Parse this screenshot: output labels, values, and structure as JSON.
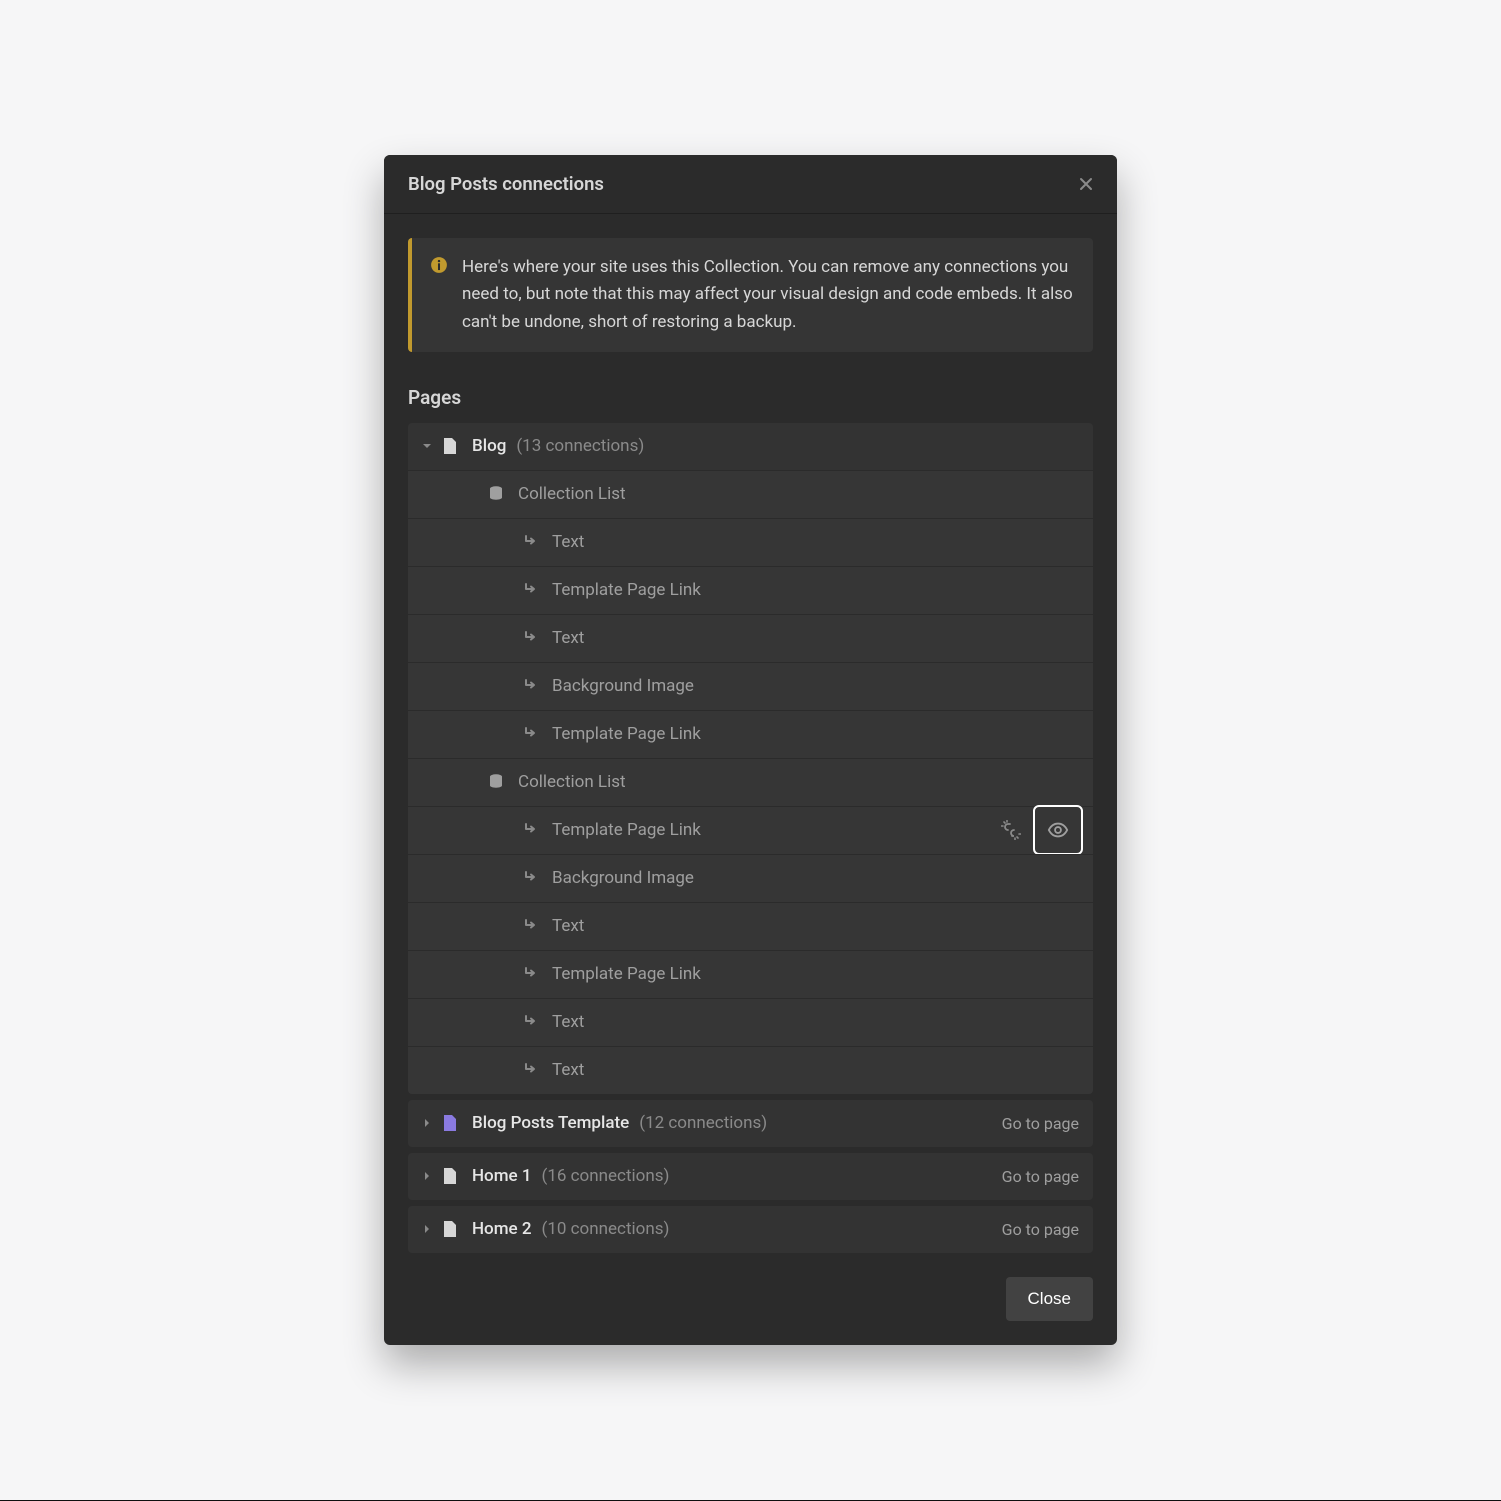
{
  "panel": {
    "title": "Blog Posts connections",
    "info_text": "Here's where your site uses this Collection. You can remove any connections you need to, but note that this may affect your visual design and code embeds. It also can't be undone, short of restoring a backup.",
    "section_title": "Pages",
    "close_button_label": "Close",
    "go_to_page_label": "Go to page"
  },
  "pages": [
    {
      "name": "Blog",
      "icon": "page",
      "connections_label": "(13 connections)",
      "expanded": true,
      "show_go_link": false,
      "children": [
        {
          "type": "collection",
          "label": "Collection List"
        },
        {
          "type": "binding",
          "label": "Text"
        },
        {
          "type": "binding",
          "label": "Template Page Link"
        },
        {
          "type": "binding",
          "label": "Text"
        },
        {
          "type": "binding",
          "label": "Background Image"
        },
        {
          "type": "binding",
          "label": "Template Page Link"
        },
        {
          "type": "collection",
          "label": "Collection List"
        },
        {
          "type": "binding",
          "label": "Template Page Link",
          "actions": true
        },
        {
          "type": "binding",
          "label": "Background Image"
        },
        {
          "type": "binding",
          "label": "Text"
        },
        {
          "type": "binding",
          "label": "Template Page Link"
        },
        {
          "type": "binding",
          "label": "Text"
        },
        {
          "type": "binding",
          "label": "Text"
        }
      ]
    },
    {
      "name": "Blog Posts Template",
      "icon": "page-purple",
      "connections_label": "(12 connections)",
      "expanded": false,
      "show_go_link": true,
      "children": []
    },
    {
      "name": "Home 1",
      "icon": "page",
      "connections_label": "(16 connections)",
      "expanded": false,
      "show_go_link": true,
      "children": []
    },
    {
      "name": "Home 2",
      "icon": "page",
      "connections_label": "(10 connections)",
      "expanded": false,
      "show_go_link": true,
      "children": []
    }
  ]
}
